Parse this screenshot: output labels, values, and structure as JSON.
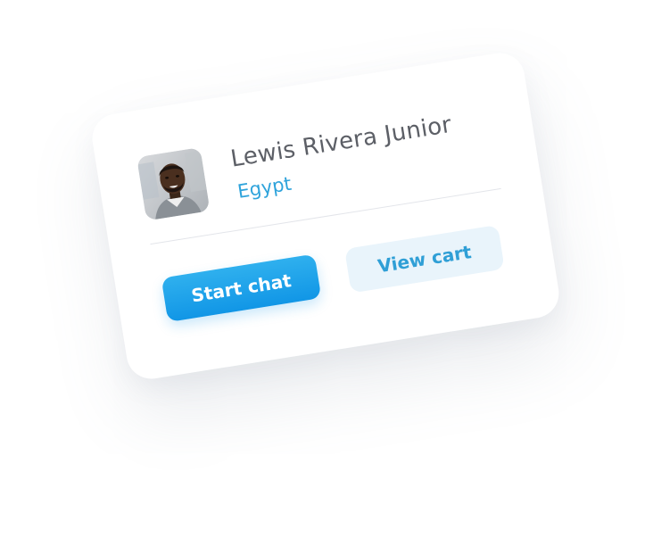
{
  "profile": {
    "name": "Lewis Rivera Junior",
    "country": "Egypt"
  },
  "actions": {
    "start_chat_label": "Start chat",
    "view_cart_label": "View cart"
  },
  "colors": {
    "name_text": "#5c5f66",
    "country_text": "#2ea3db",
    "primary_button": "#1196e6",
    "secondary_button_bg": "#e9f4fb",
    "secondary_button_text": "#2f9fd6"
  }
}
